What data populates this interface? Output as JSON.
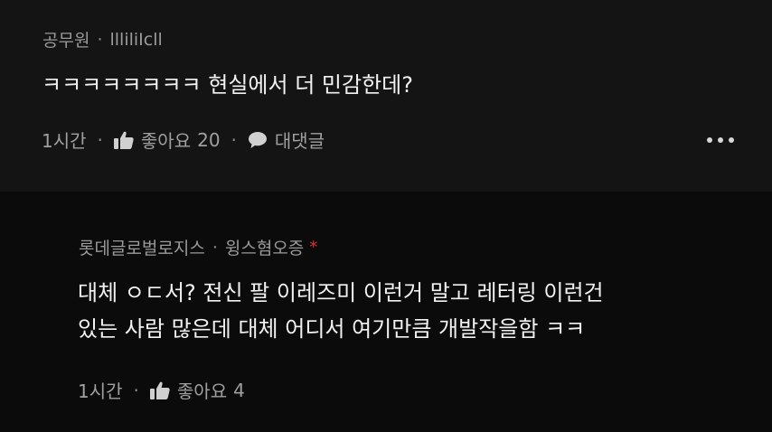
{
  "comments": [
    {
      "author": "공무원",
      "handle": "llliliIcll",
      "text_lines": [
        "ㅋㅋㅋㅋㅋㅋㅋㅋ 현실에서 더 민감한데?"
      ],
      "time": "1시간",
      "like_label": "좋아요",
      "like_count": "20",
      "reply_label": "대댓글"
    },
    {
      "author": "롯데글로벌로지스",
      "handle": "윙스혐오증",
      "marker": "*",
      "text_lines": [
        "대체 ㅇㄷ서? 전신 팔 이레즈미 이런거 말고 레터링 이런건",
        "있는 사람 많은데 대체 어디서 여기만큼 개발작을함 ㅋㅋ"
      ],
      "time": "1시간",
      "like_label": "좋아요",
      "like_count": "4"
    }
  ],
  "icons": {
    "like": "thumbs-up-icon",
    "reply": "speech-bubble-icon",
    "more": "more-options-icon"
  },
  "colors": {
    "background": "#000000",
    "comment_bg": "#141414",
    "reply_bg": "#0b0b0b",
    "meta_text": "#9a9a9a",
    "body_text": "#f2f2f2",
    "marker": "#e0322f"
  }
}
